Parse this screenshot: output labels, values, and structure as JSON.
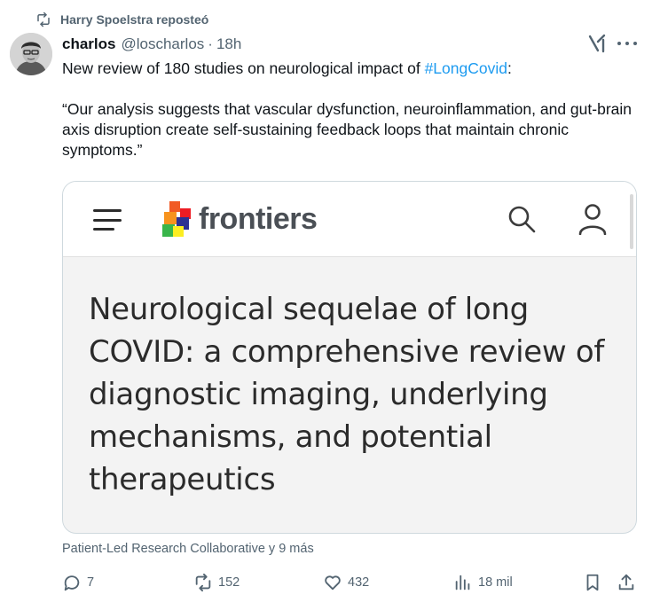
{
  "repost": {
    "icon": "repost-icon",
    "text": "Harry Spoelstra reposteó"
  },
  "author": {
    "name": "charlos",
    "handle": "@loscharlos",
    "separator": "·",
    "time": "18h"
  },
  "post": {
    "text_before": "New review of 180 studies on neurological impact of ",
    "hashtag": "#LongCovid",
    "text_after": ":",
    "quote": "“Our analysis suggests that vascular dysfunction, neuroinflammation, and gut-brain axis disruption create self-sustaining feedback loops that maintain chronic symptoms.”"
  },
  "card": {
    "brand": "frontiers",
    "title": "Neurological sequelae of long COVID: a comprehensive review of diagnostic imaging, underlying mechanisms, and potential therapeutics"
  },
  "source": "Patient-Led Research Collaborative y 9 más",
  "actions": {
    "replies": "7",
    "reposts": "152",
    "likes": "432",
    "views": "18 mil"
  },
  "colors": {
    "link": "#1d9bf0",
    "muted": "#536471",
    "text": "#0f1419"
  }
}
